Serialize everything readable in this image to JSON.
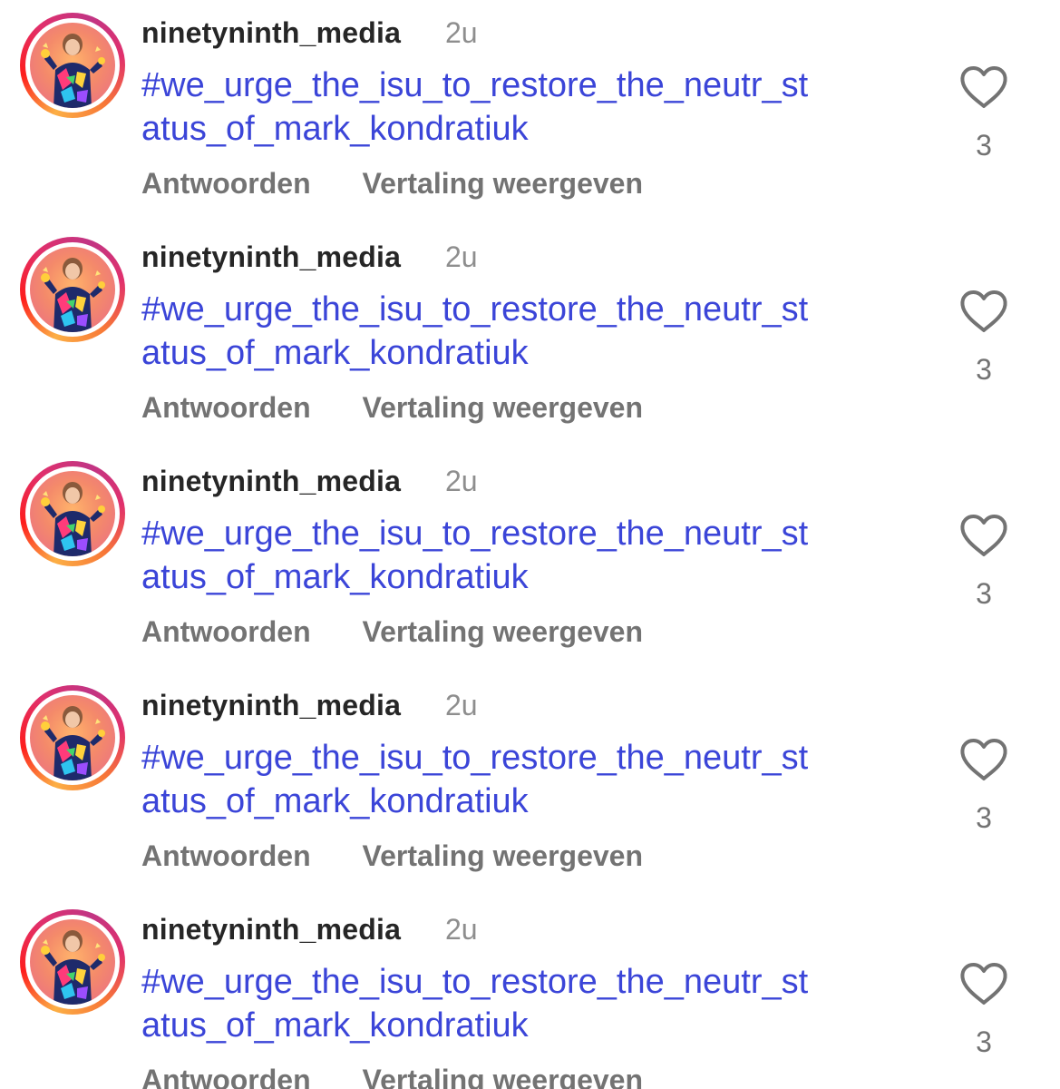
{
  "comments": [
    {
      "username": "ninetyninth_media",
      "time": "2u",
      "text_line1": "#we_urge_the_isu_to_restore_the_neutr_st",
      "text_line2": "atus_of_mark_kondratiuk",
      "reply_label": "Antwoorden",
      "translate_label": "Vertaling weergeven",
      "likes": "3"
    },
    {
      "username": "ninetyninth_media",
      "time": "2u",
      "text_line1": "#we_urge_the_isu_to_restore_the_neutr_st",
      "text_line2": "atus_of_mark_kondratiuk",
      "reply_label": "Antwoorden",
      "translate_label": "Vertaling weergeven",
      "likes": "3"
    },
    {
      "username": "ninetyninth_media",
      "time": "2u",
      "text_line1": "#we_urge_the_isu_to_restore_the_neutr_st",
      "text_line2": "atus_of_mark_kondratiuk",
      "reply_label": "Antwoorden",
      "translate_label": "Vertaling weergeven",
      "likes": "3"
    },
    {
      "username": "ninetyninth_media",
      "time": "2u",
      "text_line1": "#we_urge_the_isu_to_restore_the_neutr_st",
      "text_line2": "atus_of_mark_kondratiuk",
      "reply_label": "Antwoorden",
      "translate_label": "Vertaling weergeven",
      "likes": "3"
    },
    {
      "username": "ninetyninth_media",
      "time": "2u",
      "text_line1": "#we_urge_the_isu_to_restore_the_neutr_st",
      "text_line2": "atus_of_mark_kondratiuk",
      "reply_label": "Antwoorden",
      "translate_label": "Vertaling weergeven",
      "likes": "3"
    }
  ],
  "icons": {
    "like": "heart-outline-icon",
    "avatar_ring": "story-ring-gradient"
  },
  "colors": {
    "hashtag": "#3b45d8",
    "username": "#262626",
    "secondary": "#737373",
    "timestamp": "#8e8e8e"
  }
}
